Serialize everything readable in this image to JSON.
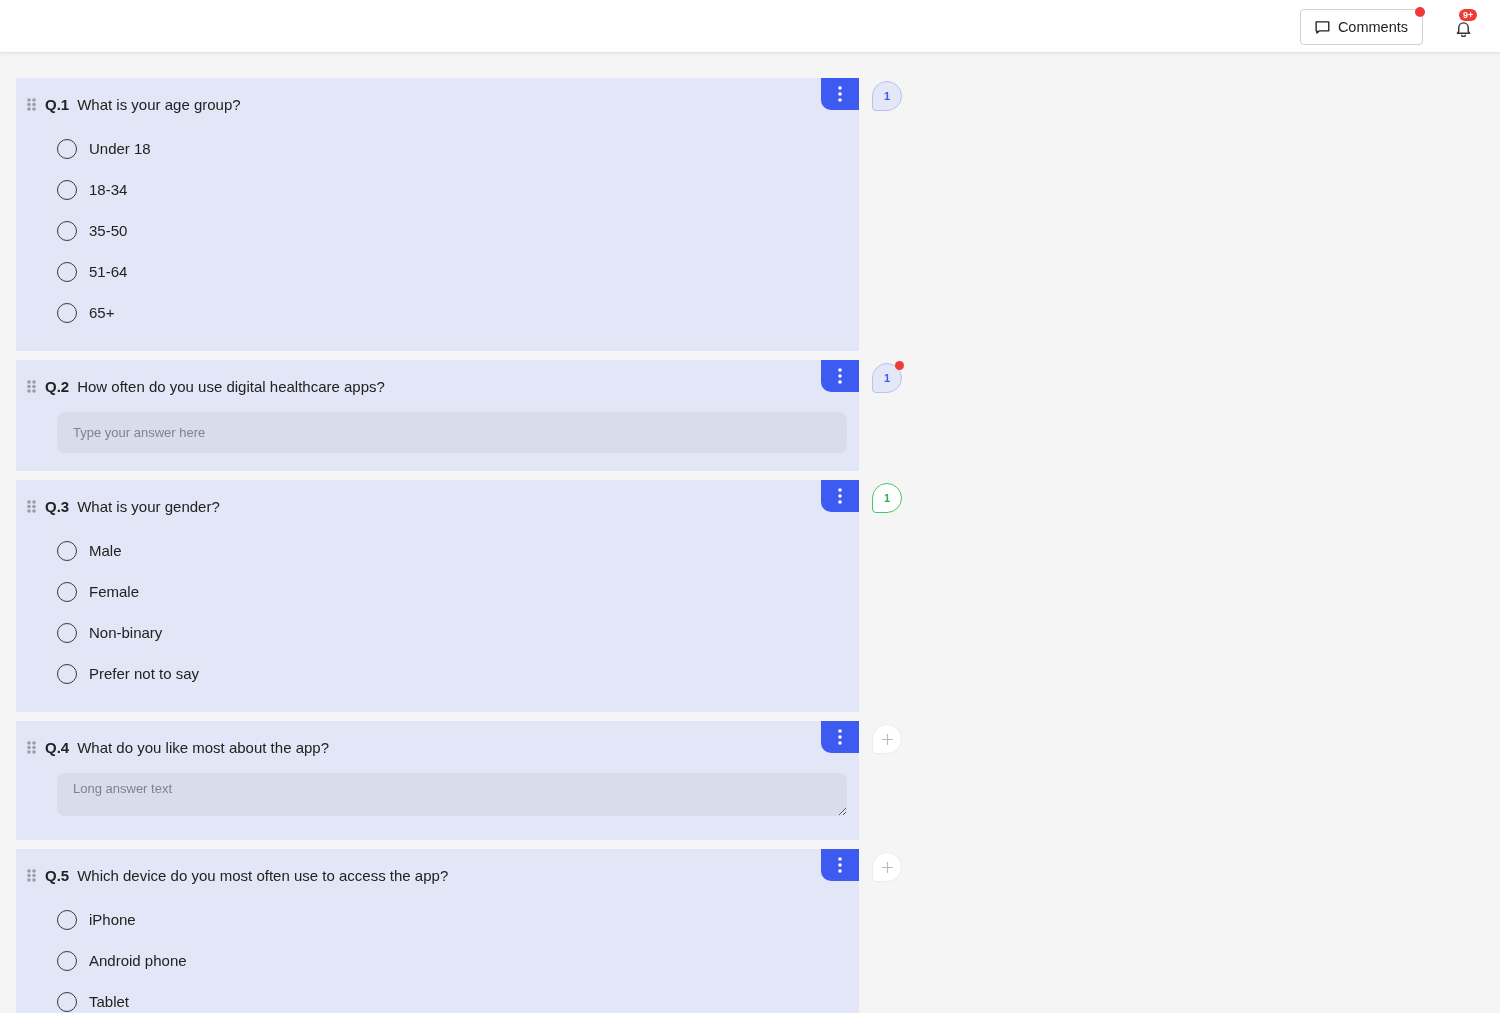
{
  "header": {
    "comments_button": {
      "label": "Comments",
      "unread": true
    },
    "notifications": {
      "badge": "9+"
    }
  },
  "questions": [
    {
      "number": "Q.1",
      "title": "What is your age group?",
      "kind": "choice",
      "options": [
        {
          "label": "Under 18",
          "selected": false
        },
        {
          "label": "18-34",
          "selected": false
        },
        {
          "label": "35-50",
          "selected": false
        },
        {
          "label": "51-64",
          "selected": false
        },
        {
          "label": "65+",
          "selected": false
        }
      ],
      "comments": {
        "kind": "count",
        "count": "1",
        "resolved": false,
        "unread": false
      }
    },
    {
      "number": "Q.2",
      "title": "How often do you use digital healthcare apps?",
      "kind": "short_text",
      "placeholder": "Type your answer here",
      "comments": {
        "kind": "count",
        "count": "1",
        "resolved": false,
        "unread": true
      }
    },
    {
      "number": "Q.3",
      "title": "What is your gender?",
      "kind": "choice",
      "options": [
        {
          "label": "Male",
          "selected": false
        },
        {
          "label": "Female",
          "selected": false
        },
        {
          "label": "Non-binary",
          "selected": false
        },
        {
          "label": "Prefer not to say",
          "selected": false
        }
      ],
      "comments": {
        "kind": "count",
        "count": "1",
        "resolved": true,
        "unread": false
      }
    },
    {
      "number": "Q.4",
      "title": "What do you like most about the app?",
      "kind": "long_text",
      "placeholder": "Long answer text",
      "comments": {
        "kind": "add"
      }
    },
    {
      "number": "Q.5",
      "title": "Which device do you most often use to access the app?",
      "kind": "choice",
      "options": [
        {
          "label": "iPhone",
          "selected": false
        },
        {
          "label": "Android phone",
          "selected": false
        },
        {
          "label": "Tablet",
          "selected": false
        }
      ],
      "comments": {
        "kind": "add"
      }
    }
  ]
}
